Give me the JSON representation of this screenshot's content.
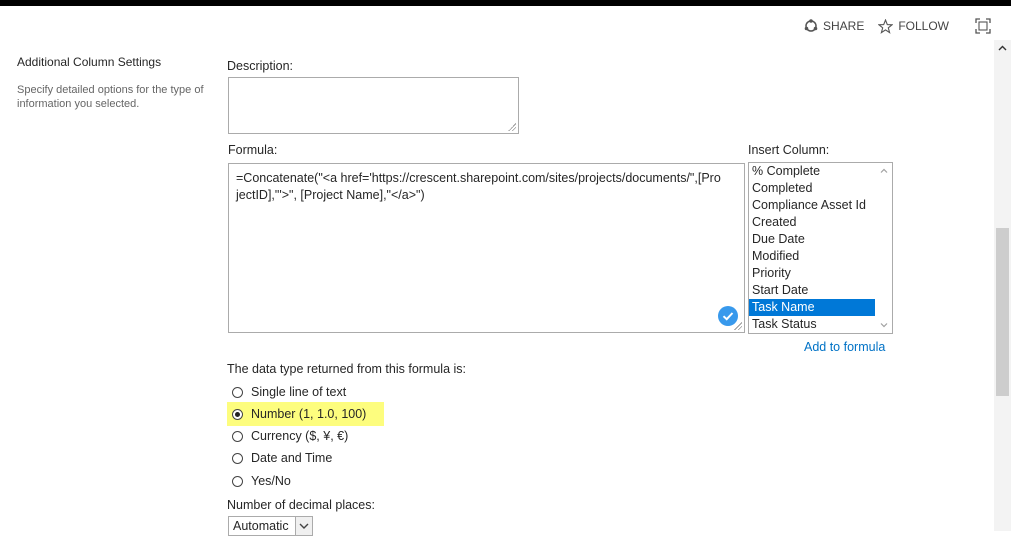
{
  "toolbar": {
    "share_label": "SHARE",
    "follow_label": "FOLLOW"
  },
  "settings": {
    "title": "Additional Column Settings",
    "description": "Specify detailed options for the type of information you selected."
  },
  "form": {
    "description_label": "Description:",
    "description_value": "",
    "formula_label": "Formula:",
    "formula_value": "=Concatenate(\"<a href='https://crescent.sharepoint.com/sites/projects/documents/\",[ProjectID],\"'>\", [Project Name],\"</a>\")",
    "insert_column_label": "Insert Column:",
    "columns": [
      "% Complete",
      "Completed",
      "Compliance Asset Id",
      "Created",
      "Due Date",
      "Modified",
      "Priority",
      "Start Date",
      "Task Name",
      "Task Status"
    ],
    "selected_column": "Task Name",
    "add_to_formula_label": "Add to formula",
    "data_type_label": "The data type returned from this formula is:",
    "data_types": [
      "Single line of text",
      "Number (1, 1.0, 100)",
      "Currency ($, ¥, €)",
      "Date and Time",
      "Yes/No"
    ],
    "selected_data_type": "Number (1, 1.0, 100)",
    "decimal_label": "Number of decimal places:",
    "decimal_value": "Automatic"
  },
  "colors": {
    "link": "#0072c6",
    "selection": "#0078d7",
    "highlight": "#fdfd7e"
  }
}
